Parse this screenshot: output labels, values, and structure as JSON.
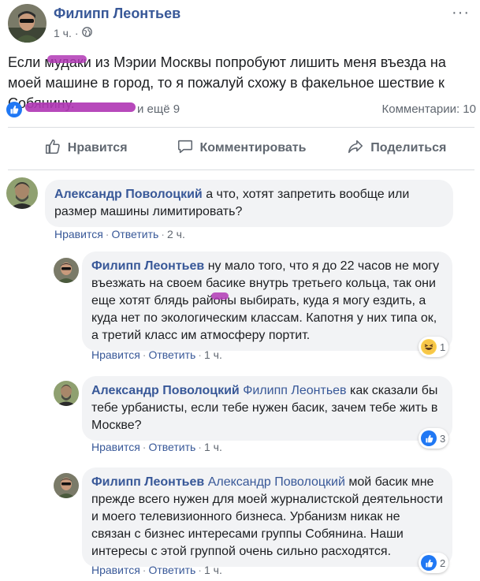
{
  "post": {
    "author": "Филипп Леонтьев",
    "time": "1 ч.",
    "privacy_icon": "globe-icon",
    "more_icon": "ellipsis-icon",
    "text": "Если мудаки из Мэрии Москвы попробуют лишить меня въезда на моей машине в город, то я пожалуй схожу в факельное шествие к Собянину.",
    "reactors": "и ещё 9",
    "comments_count": "Комментарии: 10"
  },
  "actions": {
    "like": "Нравится",
    "comment": "Комментировать",
    "share": "Поделиться"
  },
  "comments": [
    {
      "author": "Александр Поволоцкий",
      "tag": "",
      "text": "а что, хотят запретить вообще или размер машины лимитировать?",
      "like": "Нравится",
      "reply": "Ответить",
      "time": "2 ч.",
      "reaction_icon": "",
      "reaction_count": ""
    },
    {
      "author": "Филипп Леонтьев",
      "tag": "",
      "text": "ну мало того, что я до 22 часов не могу въезжать на своем басике внутрь третьего кольца, так они еще хотят блядь районы выбирать, куда я могу ездить, а куда нет по экологическим классам. Капотня у них типа ок, а третий класс им атмосферу портит.",
      "like": "Нравится",
      "reply": "Ответить",
      "time": "1 ч.",
      "reaction_icon": "haha-icon",
      "reaction_count": "1"
    },
    {
      "author": "Александр Поволоцкий",
      "tag": "Филипп Леонтьев",
      "text": "как сказали бы тебе урбанисты, если тебе нужен басик, зачем тебе жить в Москве?",
      "like": "Нравится",
      "reply": "Ответить",
      "time": "1 ч.",
      "reaction_icon": "like-icon",
      "reaction_count": "3"
    },
    {
      "author": "Филипп Леонтьев",
      "tag": "Александр Поволоцкий",
      "text": "мой басик мне прежде всего нужен для моей журналистской деятельности и моего телевизионного бизнеса. Урбанизм никак не связан с бизнес интересами группы Собянина. Наши интересы с этой группой очень сильно расходятся.",
      "like": "Нравится",
      "reply": "Ответить",
      "time": "1 ч.",
      "reaction_icon": "like-icon",
      "reaction_count": "2"
    }
  ]
}
